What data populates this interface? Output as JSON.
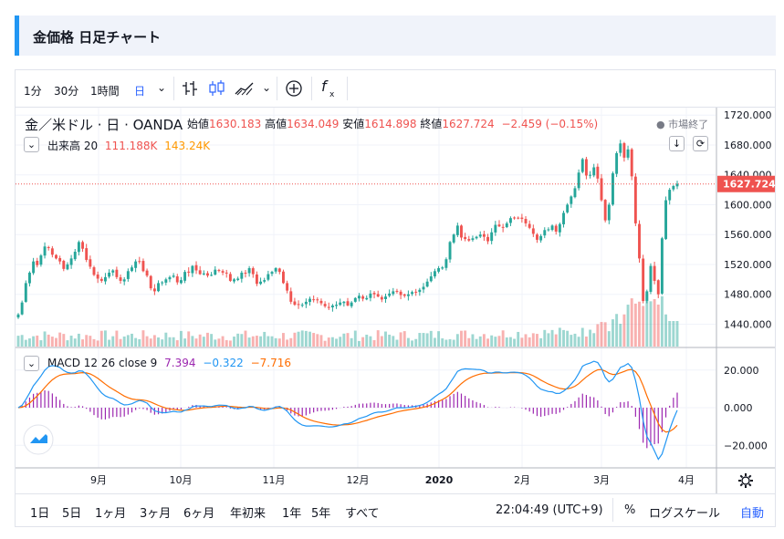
{
  "page": {
    "title": "金価格 日足チャート"
  },
  "toolbar": {
    "intervals": [
      "1分",
      "30分",
      "1時間",
      "日"
    ],
    "active_interval": "日"
  },
  "legend": {
    "symbol": "金／米ドル · 日 · OANDA",
    "open_label": "始値",
    "open_value": "1630.183",
    "high_label": "高値",
    "high_value": "1634.049",
    "low_label": "安値",
    "low_value": "1614.898",
    "close_label": "終値",
    "close_value": "1627.724",
    "change": "−2.459 (−0.15%)",
    "market_status": "● 市場終了",
    "volume_label": "出来高 20",
    "volume_value1": "111.188K",
    "volume_value2": "143.24K",
    "macd_label": "MACD 12 26 close 9",
    "macd_hist": "7.394",
    "macd_line": "−0.322",
    "macd_signal": "−7.716"
  },
  "bottom": {
    "ranges": [
      "1日",
      "5日",
      "1ヶ月",
      "3ヶ月",
      "6ヶ月",
      "年初来",
      "1年",
      "5年",
      "すべて"
    ],
    "time": "22:04:49 (UTC+9)",
    "percent": "%",
    "log_scale": "ログスケール",
    "auto": "自動"
  },
  "colors": {
    "up": "#26a69a",
    "down": "#ef5350",
    "macd": "#2196f3",
    "signal": "#ff6d00",
    "hist": "#9c27b0",
    "accent": "#2962ff"
  },
  "chart_data": [
    {
      "type": "candlestick",
      "title": "金／米ドル · 日 · OANDA",
      "ylim": [
        1410,
        1730
      ],
      "y_ticks": [
        "1720.000",
        "1680.000",
        "1640.000",
        "1600.000",
        "1560.000",
        "1520.000",
        "1480.000",
        "1440.000"
      ],
      "x_tick_labels": [
        "9月",
        "10月",
        "11月",
        "12月",
        "2020",
        "2月",
        "3月",
        "4月"
      ],
      "last_price": "1627.724",
      "close_series": [
        1453,
        1469,
        1495,
        1509,
        1524,
        1519,
        1532,
        1544,
        1542,
        1533,
        1528,
        1524,
        1514,
        1520,
        1528,
        1537,
        1550,
        1541,
        1526,
        1517,
        1506,
        1501,
        1498,
        1503,
        1509,
        1512,
        1503,
        1498,
        1500,
        1511,
        1516,
        1524,
        1524,
        1511,
        1505,
        1488,
        1484,
        1495,
        1496,
        1500,
        1503,
        1505,
        1496,
        1499,
        1510,
        1509,
        1518,
        1512,
        1507,
        1508,
        1505,
        1506,
        1513,
        1512,
        1509,
        1508,
        1498,
        1500,
        1501,
        1509,
        1508,
        1515,
        1507,
        1494,
        1497,
        1499,
        1507,
        1510,
        1515,
        1510,
        1495,
        1485,
        1470,
        1466,
        1466,
        1466,
        1470,
        1474,
        1473,
        1472,
        1468,
        1464,
        1463,
        1465,
        1466,
        1469,
        1470,
        1465,
        1469,
        1475,
        1478,
        1474,
        1475,
        1481,
        1480,
        1477,
        1473,
        1477,
        1481,
        1484,
        1484,
        1479,
        1478,
        1480,
        1483,
        1483,
        1486,
        1490,
        1497,
        1504,
        1511,
        1515,
        1516,
        1527,
        1550,
        1560,
        1572,
        1556,
        1554,
        1552,
        1555,
        1557,
        1560,
        1557,
        1551,
        1563,
        1573,
        1571,
        1569,
        1575,
        1582,
        1582,
        1582,
        1581,
        1575,
        1569,
        1561,
        1553,
        1558,
        1566,
        1567,
        1572,
        1564,
        1574,
        1589,
        1600,
        1611,
        1622,
        1643,
        1661,
        1639,
        1640,
        1650,
        1635,
        1606,
        1579,
        1600,
        1642,
        1669,
        1682,
        1663,
        1674,
        1638,
        1575,
        1528,
        1471,
        1484,
        1518,
        1498,
        1480,
        1555,
        1606,
        1620,
        1625,
        1628
      ]
    },
    {
      "type": "bar",
      "title": "出来高 20",
      "values": [
        "111.188K",
        "143.24K"
      ]
    },
    {
      "type": "line",
      "title": "MACD 12 26 close 9",
      "ylim": [
        -32,
        32
      ],
      "y_ticks": [
        "20.000",
        "0.000",
        "−20.000"
      ],
      "series": [
        {
          "name": "MACD",
          "last": "−0.322"
        },
        {
          "name": "Signal",
          "last": "−7.716"
        },
        {
          "name": "Histogram",
          "last": "7.394"
        }
      ]
    }
  ]
}
